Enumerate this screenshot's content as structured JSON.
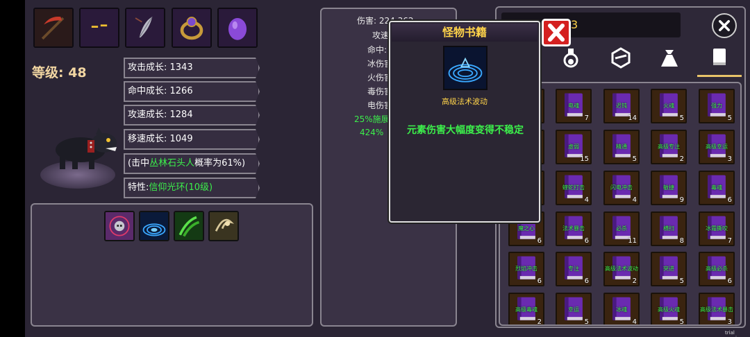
{
  "level": "等级: 48",
  "equip_slots": [
    {
      "icon": "scythe-icon"
    },
    {
      "icon": "eyes-icon"
    },
    {
      "icon": "feather-icon"
    },
    {
      "icon": "ring-icon"
    },
    {
      "icon": "egg-icon"
    }
  ],
  "stats": [
    {
      "label": "攻击成长: 1343"
    },
    {
      "label": "命中成长: 1266"
    },
    {
      "label": "攻速成长: 1284"
    },
    {
      "label": "移速成长: 1049"
    }
  ],
  "hit_effect": {
    "prefix": "(击中",
    "target": "丛林石头人",
    "suffix": "概率为61%)"
  },
  "trait": {
    "prefix": "特性:",
    "value": "信仰光环(10级)"
  },
  "skills": [
    {
      "icon": "skull-target-icon"
    },
    {
      "icon": "arcane-wave-icon"
    },
    {
      "icon": "green-claw-icon"
    },
    {
      "icon": "whirlwind-icon"
    }
  ],
  "middle_stats": [
    {
      "text": "伤害: 224 362",
      "green": false
    },
    {
      "text": "攻速",
      "green": false
    },
    {
      "text": "命中:",
      "green": false
    },
    {
      "text": "冰伤害",
      "green": false
    },
    {
      "text": "火伤害",
      "green": false
    },
    {
      "text": "毒伤害",
      "green": false
    },
    {
      "text": "电伤害",
      "green": false
    },
    {
      "text": "25%施展",
      "green": true
    },
    {
      "text": "424%",
      "green": true
    }
  ],
  "popup": {
    "title": "怪物书籍",
    "icon": "arcane-wave-icon",
    "name": "高级法术波动",
    "description": "元素伤害大幅度变得不稳定"
  },
  "right_title": "3",
  "tabs": [
    {
      "icon": "potion-icon"
    },
    {
      "icon": "cube-icon"
    },
    {
      "icon": "bag-icon"
    },
    {
      "icon": "book-icon",
      "active": true
    }
  ],
  "books": [
    {
      "name": "",
      "count": ""
    },
    {
      "name": "电魂",
      "count": "7"
    },
    {
      "name": "迟钝",
      "count": "14"
    },
    {
      "name": "火魂",
      "count": "5"
    },
    {
      "name": "强力",
      "count": "5"
    },
    {
      "name": "",
      "count": ""
    },
    {
      "name": "虚弱",
      "count": "15"
    },
    {
      "name": "精通",
      "count": "5"
    },
    {
      "name": "高级专注",
      "count": "2"
    },
    {
      "name": "高级幸运",
      "count": "3"
    },
    {
      "name": "",
      "count": ""
    },
    {
      "name": "蝰蛇打击",
      "count": "4"
    },
    {
      "name": "闪电冲击",
      "count": "4"
    },
    {
      "name": "敏捷",
      "count": "9"
    },
    {
      "name": "毒魂",
      "count": "6"
    },
    {
      "name": "魔之心",
      "count": "6"
    },
    {
      "name": "法术暴击",
      "count": "6"
    },
    {
      "name": "必杀",
      "count": "11"
    },
    {
      "name": "横扫",
      "count": "8"
    },
    {
      "name": "冰霜撕咬",
      "count": "7"
    },
    {
      "name": "烈焰冲击",
      "count": "6"
    },
    {
      "name": "专注",
      "count": "6"
    },
    {
      "name": "高级法术波动",
      "count": "2"
    },
    {
      "name": "突进",
      "count": "5"
    },
    {
      "name": "高级必杀",
      "count": "6"
    },
    {
      "name": "高级毒魂",
      "count": "2"
    },
    {
      "name": "幸运",
      "count": "5"
    },
    {
      "name": "冰魂",
      "count": "4"
    },
    {
      "name": "高级火魂",
      "count": "5"
    },
    {
      "name": "高级法术暴击",
      "count": "3"
    }
  ],
  "watermark": "trial version"
}
